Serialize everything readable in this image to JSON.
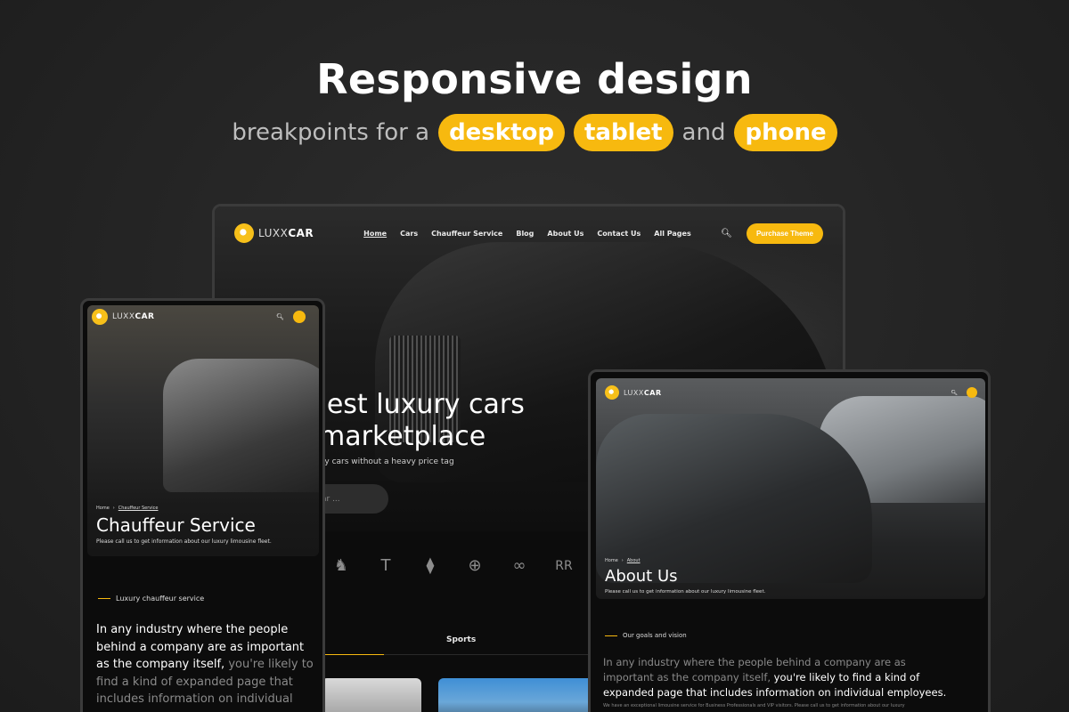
{
  "header": {
    "title": "Responsive design",
    "subtitle_prefix": "breakpoints for a",
    "pill_desktop": "desktop",
    "pill_tablet": "tablet",
    "subtitle_and": "and",
    "pill_phone": "phone"
  },
  "brand": {
    "logo_light": "LUXX",
    "logo_bold": "CAR"
  },
  "desktop": {
    "nav": [
      "Home",
      "Cars",
      "Chauffeur Service",
      "Blog",
      "About Us",
      "Contact Us",
      "All Pages"
    ],
    "cta": "Purchase Theme",
    "headline_1": "rgest luxury cars",
    "headline_2": "marketplace",
    "tagline": "ury cars without a heavy price tag",
    "search_fragment": "ar ...",
    "brand_icons": [
      "ferrari-icon",
      "tesla-icon",
      "lincoln-icon",
      "mercedes-icon",
      "infiniti-icon",
      "rolls-royce-icon"
    ],
    "brand_glyphs": [
      "♞",
      "T",
      "⧫",
      "⊕",
      "∞",
      "RR"
    ],
    "tab_sports": "Sports"
  },
  "tablet_left": {
    "crumb_home": "Home",
    "crumb_current": "Chauffeur Service",
    "title": "Chauffeur Service",
    "description": "Please call us to get information about our luxury limousine fleet.",
    "section_tag": "Luxury chauffeur service",
    "para_bold": "In any industry where the people behind a company are as important as the company itself,",
    "para_muted": " you're likely to find a kind of expanded page that includes information on individual"
  },
  "tablet_right": {
    "crumb_home": "Home",
    "crumb_current": "About",
    "title": "About Us",
    "description": "Please call us to get information about our luxury limousine fleet.",
    "section_tag": "Our goals and vision",
    "para_muted": "In any industry where the people behind a company are as important as the company itself,",
    "para_bold": " you're likely to find a kind of expanded page that includes information on individual employees.",
    "small_text": "We have an exceptional limousine service for Business Professionals and VIP visitors. Please call us to get information about our luxury"
  },
  "colors": {
    "accent": "#f7b90f",
    "background": "#232323"
  }
}
